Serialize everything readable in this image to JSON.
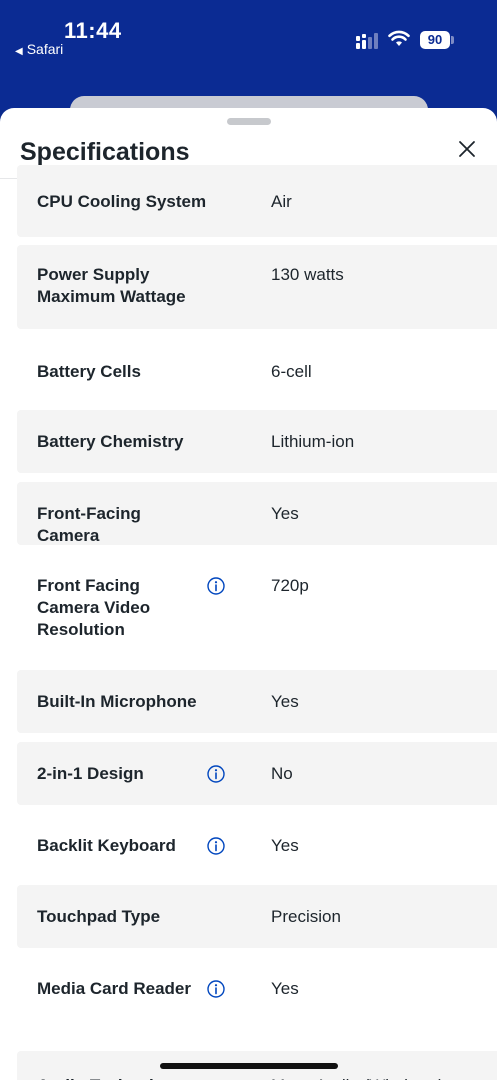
{
  "status_bar": {
    "time": "11:44",
    "back_app": "Safari",
    "battery_level": "90"
  },
  "sheet": {
    "title": "Specifications",
    "close_icon": "close-x-icon"
  },
  "specs": [
    {
      "label": "CPU Cooling System",
      "value": "Air",
      "info": false,
      "shaded": true
    },
    {
      "label": "Power Supply Maximum Wattage",
      "value": "130 watts",
      "info": false,
      "shaded": true
    },
    {
      "label": "Battery Cells",
      "value": "6-cell",
      "info": false,
      "shaded": false
    },
    {
      "label": "Battery Chemistry",
      "value": "Lithium-ion",
      "info": false,
      "shaded": true
    },
    {
      "label": "Front-Facing Camera",
      "value": "Yes",
      "info": false,
      "shaded": true
    },
    {
      "label": "Front Facing Camera Video Resolution",
      "value": "720p",
      "info": true,
      "shaded": false
    },
    {
      "label": "Built-In Microphone",
      "value": "Yes",
      "info": false,
      "shaded": true
    },
    {
      "label": "2-in-1 Design",
      "value": "No",
      "info": true,
      "shaded": true
    },
    {
      "label": "Backlit Keyboard",
      "value": "Yes",
      "info": true,
      "shaded": false
    },
    {
      "label": "Touchpad Type",
      "value": "Precision",
      "info": false,
      "shaded": true
    },
    {
      "label": "Media Card Reader",
      "value": "Yes",
      "info": true,
      "shaded": false
    },
    {
      "label": "Audio Technology",
      "value": "Maxx Audio (Windows)",
      "info": false,
      "shaded": true
    }
  ],
  "colors": {
    "header_blue": "#0b2b93",
    "row_shade": "#f4f4f4",
    "info_icon": "#0046be"
  }
}
